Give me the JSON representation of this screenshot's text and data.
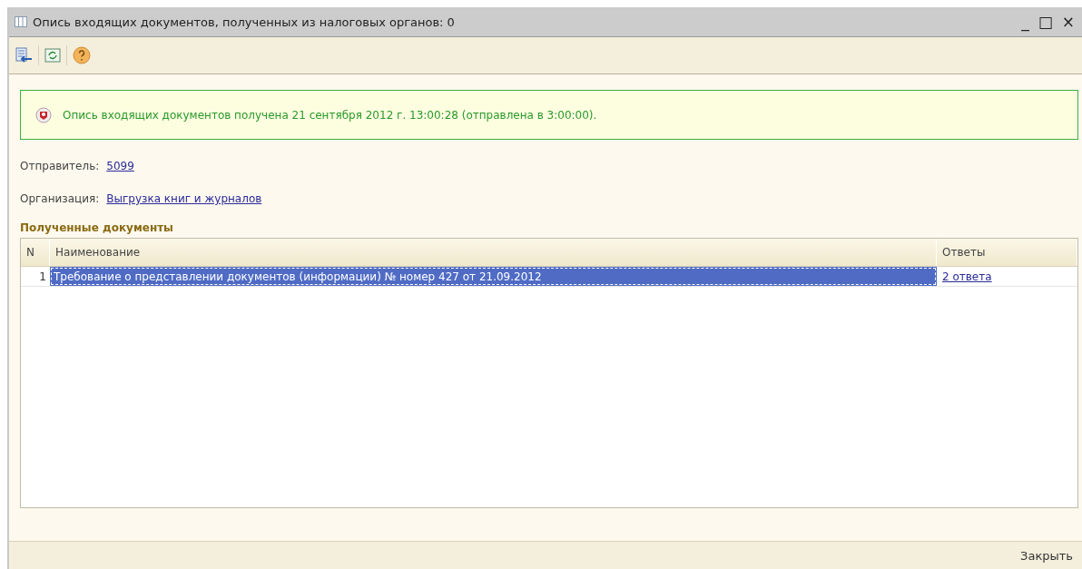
{
  "window": {
    "title": "Опись входящих документов, полученных из налоговых органов: 0",
    "controls": [
      "_",
      "□",
      "×"
    ]
  },
  "notice": {
    "text": "Опись входящих документов получена 21 сентября 2012 г. 13:00:28 (отправлена в 3:00:00)."
  },
  "fields": [
    {
      "label": "Отправитель:",
      "value": "5099"
    },
    {
      "label": "Организация:",
      "value": "Выгрузка книг и журналов"
    }
  ],
  "section_title": "Полученные документы",
  "table": {
    "columns": [
      "N",
      "Наименование",
      "Ответы"
    ],
    "rows": [
      {
        "n": "1",
        "name": "Требование о представлении документов (информации) № номер 427 от 21.09.2012",
        "answers": "2 ответа",
        "selected": true
      }
    ]
  },
  "footer": {
    "close_button": "Закрыть"
  }
}
